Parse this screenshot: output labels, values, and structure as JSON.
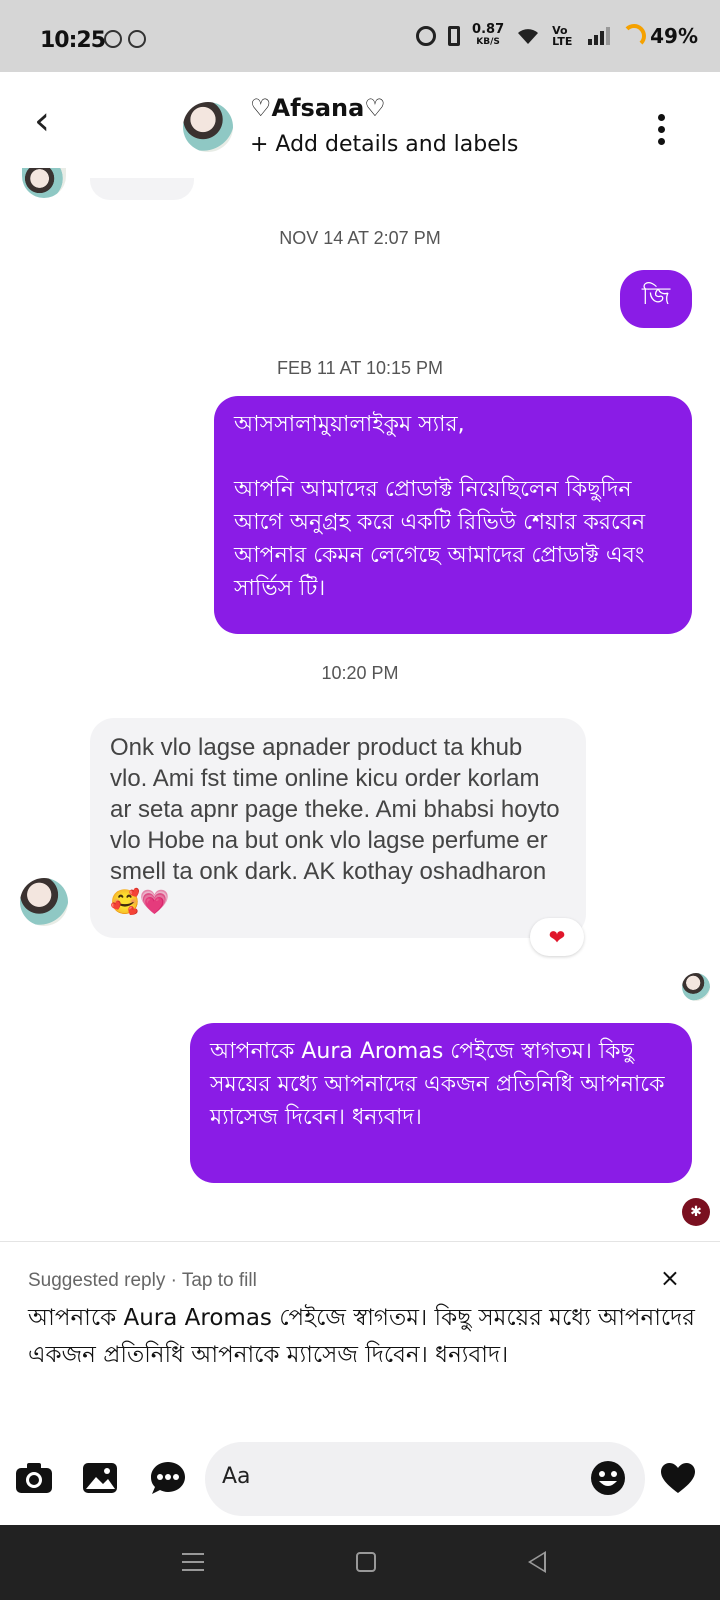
{
  "status_bar": {
    "time": "10:25",
    "speed_value": "0.87",
    "speed_unit": "KB/S",
    "volte": "Vo LTE",
    "battery": "49%"
  },
  "header": {
    "contact_name": "♡Afsana♡",
    "subtitle": "+ Add details and labels"
  },
  "messages": {
    "ts1": "NOV 14 AT 2:07 PM",
    "out1": "জি",
    "ts2": "FEB 11 AT 10:15 PM",
    "out2_line1": "আসসালামুয়ালাইকুম স্যার,",
    "out2_line2": " আপনি আমাদের প্রোডাক্ট নিয়েছিলেন কিছুদিন আগে অনুগ্রহ করে একটি রিভিউ শেয়ার করবেন আপনার কেমন লেগেছে আমাদের প্রোডাক্ট এবং সার্ভিস টি।",
    "ts3": "10:20 PM",
    "in1": "Onk vlo lagse apnader product ta khub vlo. Ami fst time online kicu order korlam ar seta apnr page theke. Ami bhabsi hoyto vlo Hobe na but onk vlo lagse perfume er smell ta onk dark. AK kothay oshadharon 🥰💗",
    "in1_reaction": "❤",
    "out3": "আপনাকে Aura Aromas পেইজে স্বাগতম। কিছু সময়ের মধ্যে আপনাদের একজন প্রতিনিধি আপনাকে ম্যাসেজ দিবেন। ধন্যবাদ।"
  },
  "suggested_reply": {
    "label": "Suggested reply · Tap to fill",
    "close": "×",
    "text": "আপনাকে Aura Aromas পেইজে স্বাগতম। কিছু সময়ের মধ্যে আপনাদের একজন প্রতিনিধি আপনাকে ম্যাসেজ দিবেন। ধন্যবাদ।"
  },
  "composer": {
    "placeholder": "Aa",
    "icons": [
      "camera-icon",
      "gallery-icon",
      "more-icon",
      "emoji-icon",
      "like-heart-icon"
    ]
  },
  "colors": {
    "accent": "#8a1ce6",
    "incoming_bubble": "#f3f3f5",
    "reaction_heart": "#e0162b"
  }
}
